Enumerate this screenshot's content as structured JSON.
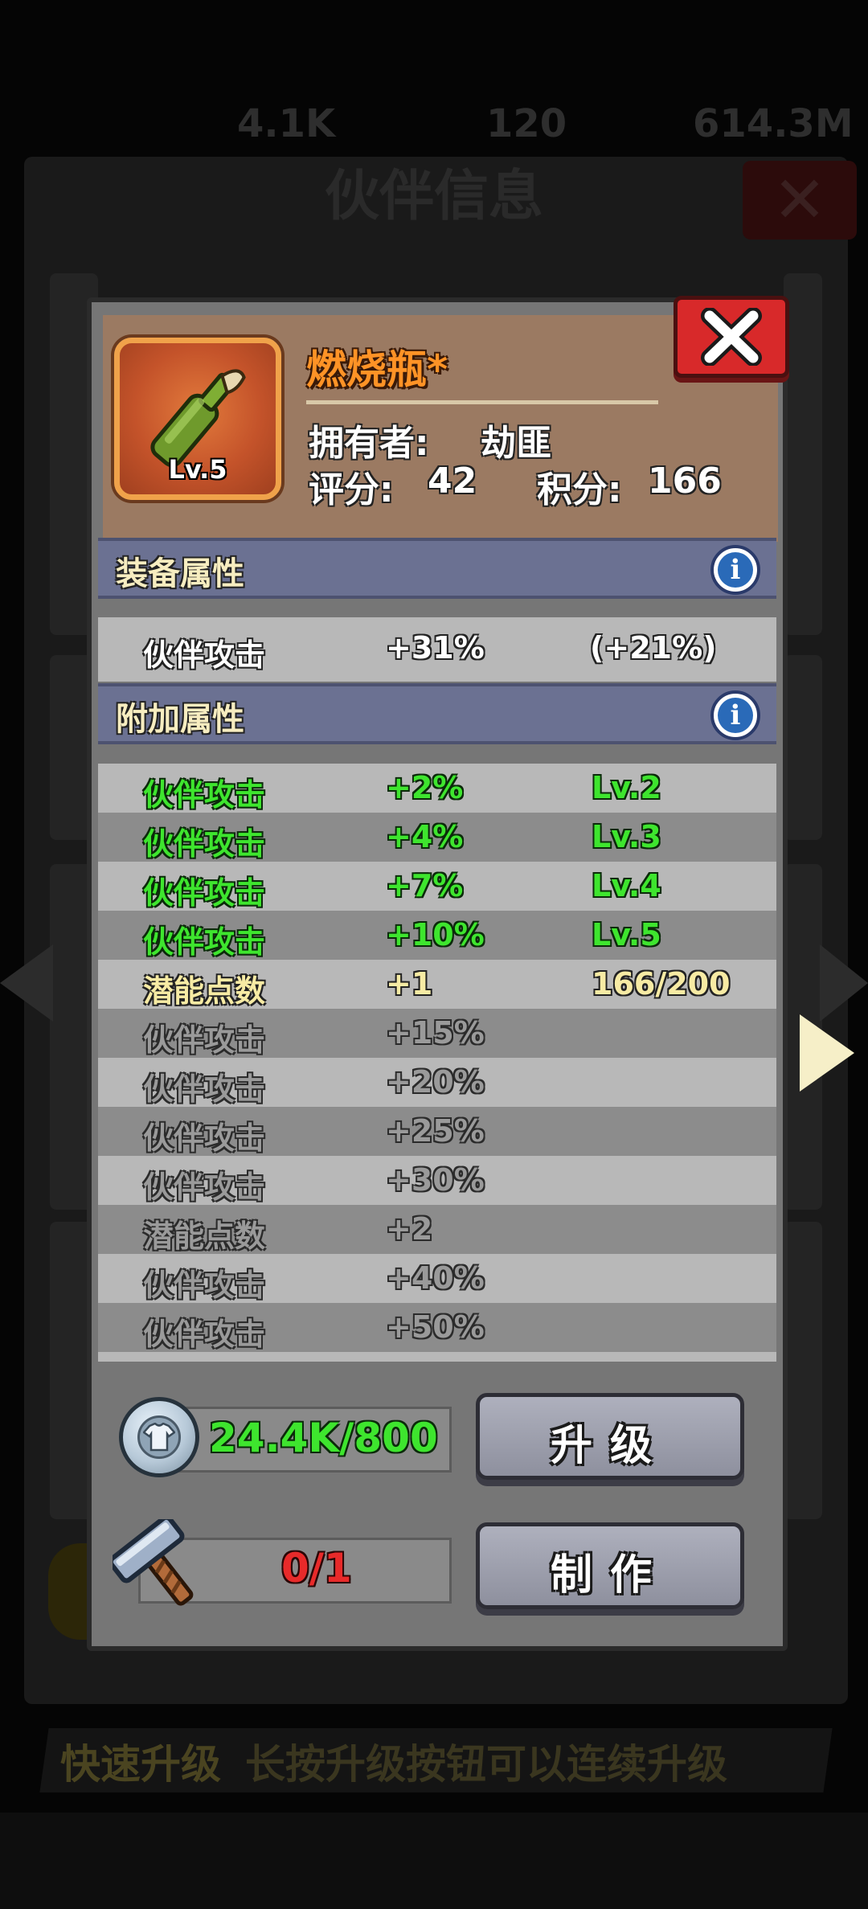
{
  "background": {
    "top_stats": [
      "4.1K",
      "120",
      "614.3M"
    ],
    "title": "伙伴信息",
    "hint_emphasis": "快速升级",
    "hint_text": "长按升级按钮可以连续升级"
  },
  "item": {
    "name": "燃烧瓶*",
    "level": "Lv.5",
    "owner_label": "拥有者:",
    "owner_value": "劫匪",
    "score_label": "评分:",
    "score_value": "42",
    "points_label": "积分:",
    "points_value": "166"
  },
  "equip_section": {
    "title": "装备属性",
    "rows": [
      {
        "name": "伙伴攻击",
        "value": "+31%",
        "extra": "(+21%)"
      }
    ]
  },
  "extra_section": {
    "title": "附加属性",
    "rows": [
      {
        "name": "伙伴攻击",
        "value": "+2%",
        "extra": "Lv.2",
        "state": "unlocked"
      },
      {
        "name": "伙伴攻击",
        "value": "+4%",
        "extra": "Lv.3",
        "state": "unlocked"
      },
      {
        "name": "伙伴攻击",
        "value": "+7%",
        "extra": "Lv.4",
        "state": "unlocked"
      },
      {
        "name": "伙伴攻击",
        "value": "+10%",
        "extra": "Lv.5",
        "state": "unlocked"
      },
      {
        "name": "潜能点数",
        "value": "+1",
        "extra": "166/200",
        "state": "progress"
      },
      {
        "name": "伙伴攻击",
        "value": "+15%",
        "extra": "",
        "state": "locked"
      },
      {
        "name": "伙伴攻击",
        "value": "+20%",
        "extra": "",
        "state": "locked"
      },
      {
        "name": "伙伴攻击",
        "value": "+25%",
        "extra": "",
        "state": "locked"
      },
      {
        "name": "伙伴攻击",
        "value": "+30%",
        "extra": "",
        "state": "locked"
      },
      {
        "name": "潜能点数",
        "value": "+2",
        "extra": "",
        "state": "locked"
      },
      {
        "name": "伙伴攻击",
        "value": "+40%",
        "extra": "",
        "state": "locked"
      },
      {
        "name": "伙伴攻击",
        "value": "+50%",
        "extra": "",
        "state": "locked"
      }
    ]
  },
  "upgrade": {
    "resource": "24.4K/800",
    "button_label": "升级"
  },
  "craft": {
    "resource": "0/1",
    "button_label": "制作"
  },
  "colors": {
    "unlocked": "#3ee52e",
    "progress": "#f7eba4",
    "locked": "#9a9a9a",
    "item_name": "#ff9326",
    "close_button": "#d8292a",
    "section_header": "#6b7192",
    "craft_count": "#e82a2a"
  },
  "icons": {
    "item": "molotov-bottle-icon",
    "close": "close-x-icon",
    "info": "info-icon",
    "upgrade_currency": "silver-coin-icon",
    "craft_material": "hammer-icon",
    "next": "arrow-right-icon",
    "prev": "arrow-left-icon"
  }
}
